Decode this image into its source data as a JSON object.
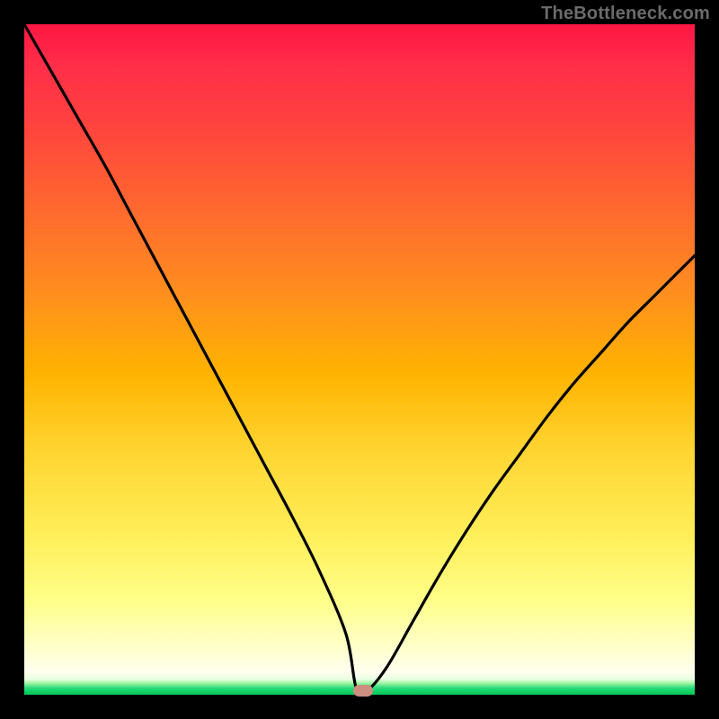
{
  "watermark": "TheBottleneck.com",
  "colors": {
    "frame": "#000000",
    "curve": "#000000",
    "marker": "#cd8d80"
  },
  "chart_data": {
    "type": "line",
    "title": "",
    "xlabel": "",
    "ylabel": "",
    "xlim": [
      0,
      100
    ],
    "ylim": [
      0,
      100
    ],
    "grid": false,
    "legend": false,
    "annotations": [
      {
        "text": "TheBottleneck.com",
        "position": "top-right"
      }
    ],
    "series": [
      {
        "name": "bottleneck-curve",
        "x": [
          0,
          4,
          8,
          12,
          16,
          20,
          24,
          28,
          32,
          36,
          40,
          44,
          48,
          49.5,
          51,
          54,
          58,
          62,
          66,
          70,
          74,
          78,
          82,
          86,
          90,
          94,
          98,
          100
        ],
        "values": [
          100,
          93,
          86,
          79,
          71.5,
          64,
          56.5,
          49,
          41.5,
          34,
          26.5,
          18.5,
          9,
          1,
          0.5,
          4,
          11,
          18,
          24.5,
          30.5,
          36,
          41.5,
          46.5,
          51,
          55.5,
          59.5,
          63.5,
          65.5
        ]
      }
    ],
    "minimum_marker": {
      "x": 50.5,
      "y": 0.5
    }
  }
}
